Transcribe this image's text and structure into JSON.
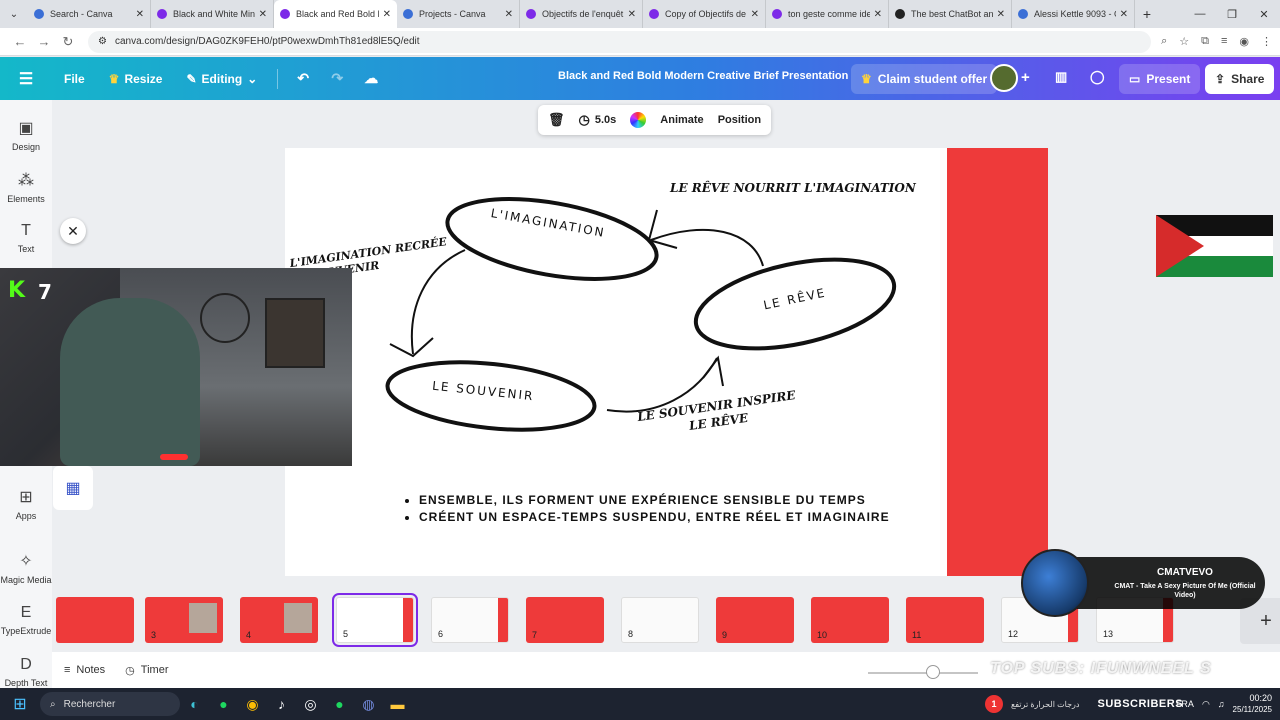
{
  "browser": {
    "tabs": [
      {
        "title": "Search - Canva",
        "icon": "canva"
      },
      {
        "title": "Black and White Mini",
        "icon": "canva-purple"
      },
      {
        "title": "Black and Red Bold M",
        "icon": "canva-purple",
        "active": true
      },
      {
        "title": "Projects - Canva",
        "icon": "canva"
      },
      {
        "title": "Objectifs de l'enquêt",
        "icon": "canva-purple"
      },
      {
        "title": "Copy of Objectifs de",
        "icon": "canva-purple"
      },
      {
        "title": "ton geste comme ide",
        "icon": "canva-purple"
      },
      {
        "title": "The best ChatBot anc",
        "icon": "chatbot"
      },
      {
        "title": "Alessi Kettle 9093 - G",
        "icon": "google"
      }
    ],
    "url": "canva.com/design/DAG0ZK9FEH0/ptP0wexwDmhTh81ed8lE5Q/edit"
  },
  "header": {
    "file": "File",
    "resize": "Resize",
    "editing": "Editing",
    "doc_title": "Black and Red Bold Modern Creative Brief Presentation",
    "claim": "Claim student offer",
    "present": "Present",
    "share": "Share"
  },
  "sidebar": {
    "design": "Design",
    "elements": "Elements",
    "text": "Text",
    "apps": "Apps",
    "magic_media": "Magic Media",
    "typeextrude": "TypeExtrude",
    "depth_text": "Depth Text"
  },
  "context_bar": {
    "duration": "5.0s",
    "animate": "Animate",
    "position": "Position"
  },
  "slide": {
    "top_caption": "LE RÊVE NOURRIT L'IMAGINATION",
    "left_caption": "L'IMAGINATION RECRÉE LE SOUVENIR",
    "bottom_caption": "LE SOUVENIR INSPIRE LE RÊVE",
    "ellipse_imagination": "L'IMAGINATION",
    "ellipse_reve": "LE RÊVE",
    "ellipse_souvenir": "LE SOUVENIR",
    "bullets": [
      "ENSEMBLE, ILS FORMENT UNE EXPÉRIENCE SENSIBLE DU TEMPS",
      "CRÉENT UN ESPACE-TEMPS SUSPENDU, ENTRE RÉEL ET IMAGINAIRE"
    ],
    "accent_color": "#ee3a3a"
  },
  "webcam": {
    "badge": "K",
    "count": "7"
  },
  "thumbnails": [
    {
      "num": "",
      "style": "red"
    },
    {
      "num": "3",
      "style": "red"
    },
    {
      "num": "4",
      "style": "red"
    },
    {
      "num": "5",
      "style": "white",
      "active": true
    },
    {
      "num": "6",
      "style": "white"
    },
    {
      "num": "7",
      "style": "red"
    },
    {
      "num": "8",
      "style": "white"
    },
    {
      "num": "9",
      "style": "red"
    },
    {
      "num": "10",
      "style": "red"
    },
    {
      "num": "11",
      "style": "red"
    },
    {
      "num": "12",
      "style": "white"
    },
    {
      "num": "13",
      "style": "white"
    }
  ],
  "music": {
    "channel": "CMATVEVO",
    "song": "CMAT - Take A Sexy Picture Of Me (Official Video)"
  },
  "bottom": {
    "notes": "Notes",
    "timer": "Timer",
    "watermark": "TOP SUBS: IFUNWNEEL S"
  },
  "taskbar": {
    "search": "Rechercher",
    "badge_count": "1",
    "arabic": "درجات الحرارة ترتفع",
    "subscribers": "SUBSCRIBERS",
    "lang": "FRA",
    "time": "00:20",
    "date": "25/11/2025"
  }
}
